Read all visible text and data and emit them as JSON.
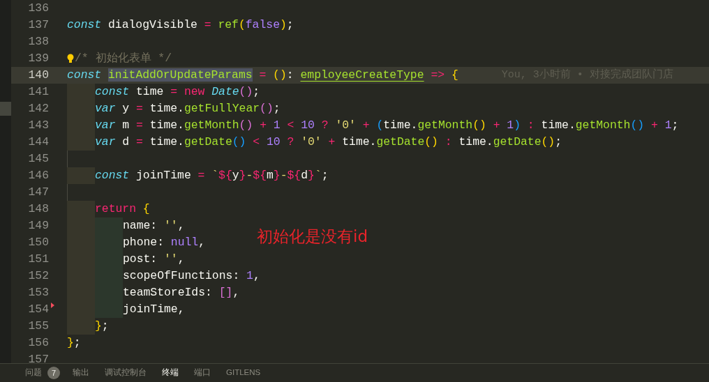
{
  "editor": {
    "lines": [
      {
        "number": "136",
        "current": false
      },
      {
        "number": "137",
        "current": false,
        "tokens": [
          {
            "text": "const",
            "kind": "storage"
          },
          {
            "text": " dialogVisible",
            "kind": "plain"
          },
          {
            "text": " = ",
            "kind": "operator"
          },
          {
            "text": "ref",
            "kind": "function"
          },
          {
            "text": "(",
            "kind": "paren1"
          },
          {
            "text": "false",
            "kind": "constant"
          },
          {
            "text": ")",
            "kind": "paren1"
          },
          {
            "text": ";",
            "kind": "plain"
          }
        ]
      },
      {
        "number": "138",
        "current": false
      },
      {
        "number": "139",
        "current": false,
        "lightbulb": true,
        "tokens": [
          {
            "text": "/* 初始化表单 */",
            "kind": "comment"
          }
        ]
      },
      {
        "number": "140",
        "current": true,
        "blame": "You, 3小时前 • 对接完成团队门店",
        "tokens": [
          {
            "text": "const ",
            "kind": "storage"
          },
          {
            "text": "initAddOrUpdateParams",
            "kind": "highlight"
          },
          {
            "text": " = ",
            "kind": "operator"
          },
          {
            "text": "(",
            "kind": "paren1"
          },
          {
            "text": ")",
            "kind": "paren1"
          },
          {
            "text": ": ",
            "kind": "plain"
          },
          {
            "text": "employeeCreateType",
            "kind": "type"
          },
          {
            "text": " => ",
            "kind": "operator"
          },
          {
            "text": "{",
            "kind": "paren1"
          }
        ]
      },
      {
        "number": "141",
        "current": false,
        "indent": [
          {
            "kind": "block"
          }
        ],
        "tokens": [
          {
            "text": "const",
            "kind": "storage"
          },
          {
            "text": " time",
            "kind": "plain"
          },
          {
            "text": " = ",
            "kind": "operator"
          },
          {
            "text": "new ",
            "kind": "keyword"
          },
          {
            "text": "Date",
            "kind": "class"
          },
          {
            "text": "()",
            "kind": "paren2"
          },
          {
            "text": ";",
            "kind": "plain"
          }
        ]
      },
      {
        "number": "142",
        "current": false,
        "indent": [
          {
            "kind": "block"
          }
        ],
        "tokens": [
          {
            "text": "var",
            "kind": "storage"
          },
          {
            "text": " y",
            "kind": "plain"
          },
          {
            "text": " = ",
            "kind": "operator"
          },
          {
            "text": "time.",
            "kind": "plain"
          },
          {
            "text": "getFullYear",
            "kind": "function"
          },
          {
            "text": "()",
            "kind": "paren2"
          },
          {
            "text": ";",
            "kind": "plain"
          }
        ]
      },
      {
        "number": "143",
        "current": false,
        "indent": [
          {
            "kind": "block"
          }
        ],
        "tokens": [
          {
            "text": "var",
            "kind": "storage"
          },
          {
            "text": " m",
            "kind": "plain"
          },
          {
            "text": " = ",
            "kind": "operator"
          },
          {
            "text": "time.",
            "kind": "plain"
          },
          {
            "text": "getMonth",
            "kind": "function"
          },
          {
            "text": "()",
            "kind": "paren2"
          },
          {
            "text": " + ",
            "kind": "operator"
          },
          {
            "text": "1",
            "kind": "number"
          },
          {
            "text": " < ",
            "kind": "operator"
          },
          {
            "text": "10",
            "kind": "number"
          },
          {
            "text": " ? ",
            "kind": "operator"
          },
          {
            "text": "'0'",
            "kind": "string"
          },
          {
            "text": " + ",
            "kind": "operator"
          },
          {
            "text": "(",
            "kind": "paren3"
          },
          {
            "text": "time.",
            "kind": "plain"
          },
          {
            "text": "getMonth",
            "kind": "function"
          },
          {
            "text": "()",
            "kind": "paren1"
          },
          {
            "text": " + ",
            "kind": "operator"
          },
          {
            "text": "1",
            "kind": "number"
          },
          {
            "text": ")",
            "kind": "paren3"
          },
          {
            "text": " : ",
            "kind": "operator"
          },
          {
            "text": "time.",
            "kind": "plain"
          },
          {
            "text": "getMonth",
            "kind": "function"
          },
          {
            "text": "()",
            "kind": "paren3"
          },
          {
            "text": " + ",
            "kind": "operator"
          },
          {
            "text": "1",
            "kind": "number"
          },
          {
            "text": ";",
            "kind": "plain"
          }
        ]
      },
      {
        "number": "144",
        "current": false,
        "indent": [
          {
            "kind": "block"
          }
        ],
        "tokens": [
          {
            "text": "var",
            "kind": "storage"
          },
          {
            "text": " d",
            "kind": "plain"
          },
          {
            "text": " = ",
            "kind": "operator"
          },
          {
            "text": "time.",
            "kind": "plain"
          },
          {
            "text": "getDate",
            "kind": "function"
          },
          {
            "text": "()",
            "kind": "paren3"
          },
          {
            "text": " < ",
            "kind": "operator"
          },
          {
            "text": "10",
            "kind": "number"
          },
          {
            "text": " ? ",
            "kind": "operator"
          },
          {
            "text": "'0'",
            "kind": "string"
          },
          {
            "text": " + ",
            "kind": "operator"
          },
          {
            "text": "time.",
            "kind": "plain"
          },
          {
            "text": "getDate",
            "kind": "function"
          },
          {
            "text": "()",
            "kind": "paren1"
          },
          {
            "text": " : ",
            "kind": "operator"
          },
          {
            "text": "time.",
            "kind": "plain"
          },
          {
            "text": "getDate",
            "kind": "function"
          },
          {
            "text": "()",
            "kind": "paren1"
          },
          {
            "text": ";",
            "kind": "plain"
          }
        ]
      },
      {
        "number": "145",
        "current": false,
        "indent": [
          {
            "kind": "guide"
          }
        ]
      },
      {
        "number": "146",
        "current": false,
        "indent": [
          {
            "kind": "block"
          }
        ],
        "tokens": [
          {
            "text": "const",
            "kind": "storage"
          },
          {
            "text": " joinTime",
            "kind": "plain"
          },
          {
            "text": " = ",
            "kind": "operator"
          },
          {
            "text": "`",
            "kind": "string"
          },
          {
            "text": "${",
            "kind": "keyword"
          },
          {
            "text": "y",
            "kind": "plain"
          },
          {
            "text": "}",
            "kind": "keyword"
          },
          {
            "text": "-",
            "kind": "string"
          },
          {
            "text": "${",
            "kind": "keyword"
          },
          {
            "text": "m",
            "kind": "plain"
          },
          {
            "text": "}",
            "kind": "keyword"
          },
          {
            "text": "-",
            "kind": "string"
          },
          {
            "text": "${",
            "kind": "keyword"
          },
          {
            "text": "d",
            "kind": "plain"
          },
          {
            "text": "}",
            "kind": "keyword"
          },
          {
            "text": "`",
            "kind": "string"
          },
          {
            "text": ";",
            "kind": "plain"
          }
        ]
      },
      {
        "number": "147",
        "current": false,
        "indent": [
          {
            "kind": "guide"
          }
        ]
      },
      {
        "number": "148",
        "current": false,
        "indent": [
          {
            "kind": "block"
          }
        ],
        "tokens": [
          {
            "text": "return ",
            "kind": "keyword"
          },
          {
            "text": "{",
            "kind": "paren1"
          }
        ]
      },
      {
        "number": "149",
        "current": false,
        "indent": [
          {
            "kind": "block"
          },
          {
            "kind": "block"
          }
        ],
        "tokens": [
          {
            "text": "name: ",
            "kind": "plain"
          },
          {
            "text": "''",
            "kind": "string"
          },
          {
            "text": ",",
            "kind": "plain"
          }
        ]
      },
      {
        "number": "150",
        "current": false,
        "indent": [
          {
            "kind": "block"
          },
          {
            "kind": "block"
          }
        ],
        "tokens": [
          {
            "text": "phone: ",
            "kind": "plain"
          },
          {
            "text": "null",
            "kind": "constant"
          },
          {
            "text": ",",
            "kind": "plain"
          }
        ]
      },
      {
        "number": "151",
        "current": false,
        "indent": [
          {
            "kind": "block"
          },
          {
            "kind": "block"
          }
        ],
        "tokens": [
          {
            "text": "post: ",
            "kind": "plain"
          },
          {
            "text": "''",
            "kind": "string"
          },
          {
            "text": ",",
            "kind": "plain"
          }
        ]
      },
      {
        "number": "152",
        "current": false,
        "indent": [
          {
            "kind": "block"
          },
          {
            "kind": "block"
          }
        ],
        "tokens": [
          {
            "text": "scopeOfFunctions: ",
            "kind": "plain"
          },
          {
            "text": "1",
            "kind": "number"
          },
          {
            "text": ",",
            "kind": "plain"
          }
        ]
      },
      {
        "number": "153",
        "current": false,
        "indent": [
          {
            "kind": "block"
          },
          {
            "kind": "block"
          }
        ],
        "tokens": [
          {
            "text": "teamStoreIds: ",
            "kind": "plain"
          },
          {
            "text": "[]",
            "kind": "paren2"
          },
          {
            "text": ",",
            "kind": "plain"
          }
        ]
      },
      {
        "number": "154",
        "current": false,
        "marker": true,
        "indent": [
          {
            "kind": "block"
          },
          {
            "kind": "block"
          }
        ],
        "tokens": [
          {
            "text": "joinTime,",
            "kind": "plain"
          }
        ]
      },
      {
        "number": "155",
        "current": false,
        "indent": [
          {
            "kind": "block"
          }
        ],
        "tokens": [
          {
            "text": "}",
            "kind": "paren1"
          },
          {
            "text": ";",
            "kind": "plain"
          }
        ]
      },
      {
        "number": "156",
        "current": false,
        "tokens": [
          {
            "text": "}",
            "kind": "paren1"
          },
          {
            "text": ";",
            "kind": "plain"
          }
        ]
      },
      {
        "number": "157",
        "current": false
      }
    ],
    "annotation": "初始化是没有id"
  },
  "panel_tabs": [
    {
      "label": "问题",
      "badge": "7",
      "selected": false
    },
    {
      "label": "输出",
      "selected": false
    },
    {
      "label": "调试控制台",
      "selected": false
    },
    {
      "label": "终端",
      "selected": true
    },
    {
      "label": "端口",
      "selected": false
    },
    {
      "label": "GITLENS",
      "selected": false
    }
  ]
}
